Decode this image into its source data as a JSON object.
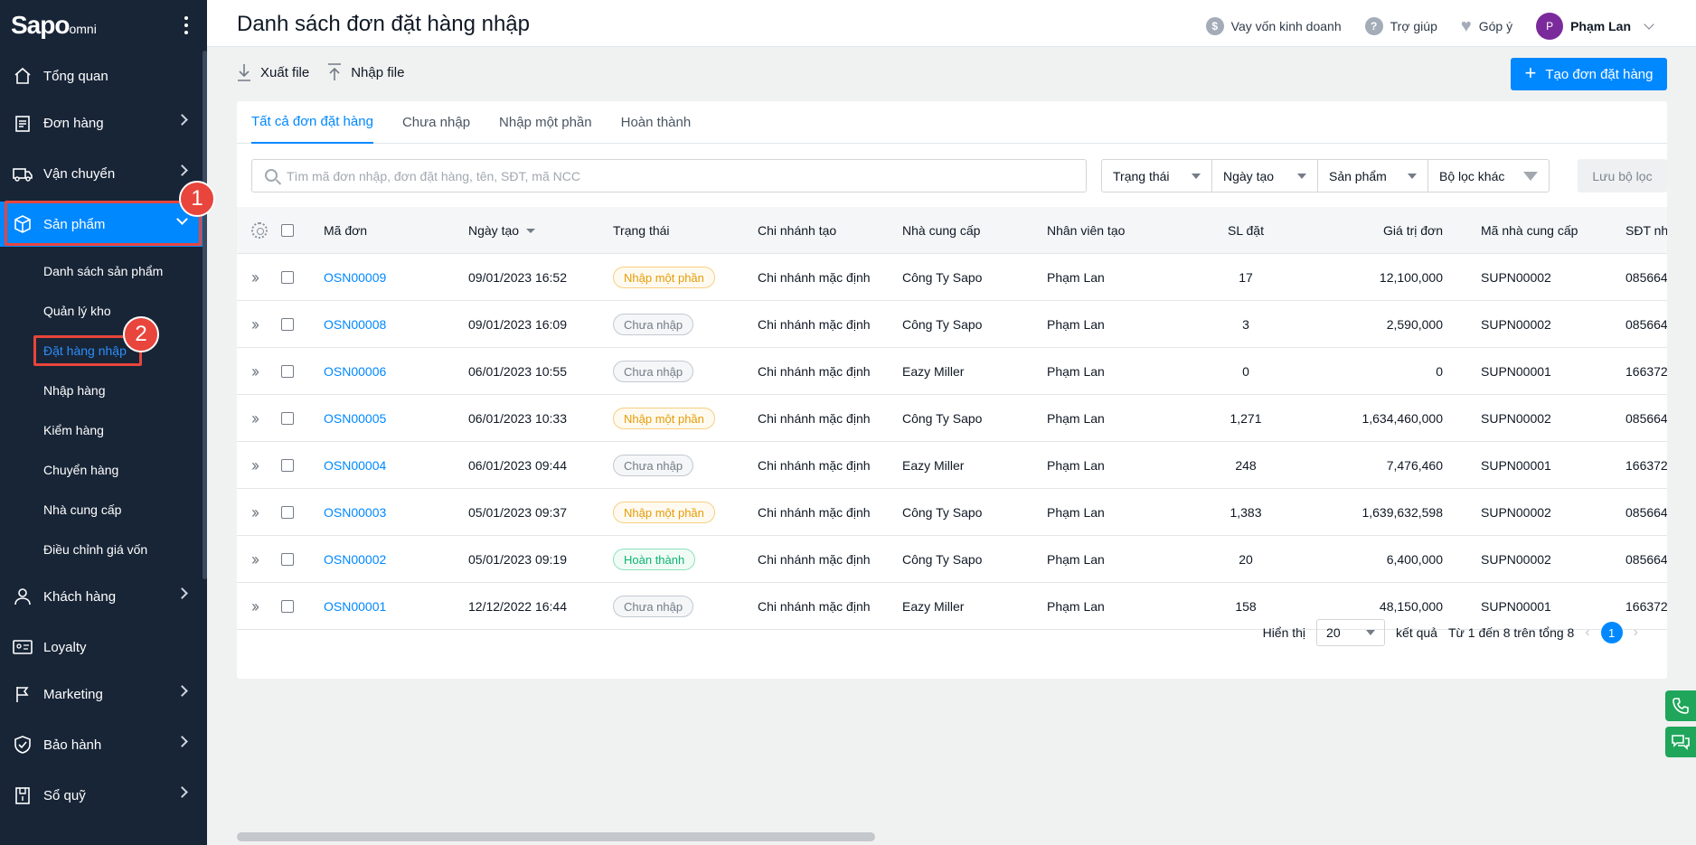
{
  "app": {
    "logo_main": "Sapo",
    "logo_sub": "omni"
  },
  "sidebar": {
    "items": [
      {
        "label": "Tổng quan",
        "icon": "home-icon"
      },
      {
        "label": "Đơn hàng",
        "icon": "clipboard-icon"
      },
      {
        "label": "Vận chuyển",
        "icon": "truck-icon"
      },
      {
        "label": "Sản phẩm",
        "icon": "box-icon"
      },
      {
        "label": "Khách hàng",
        "icon": "user-icon"
      },
      {
        "label": "Loyalty",
        "icon": "card-icon"
      },
      {
        "label": "Marketing",
        "icon": "flag-icon"
      },
      {
        "label": "Bảo hành",
        "icon": "shield-icon"
      },
      {
        "label": "Sổ quỹ",
        "icon": "ledger-icon"
      }
    ],
    "sub_items": [
      "Danh sách sản phẩm",
      "Quản lý kho",
      "Đặt hàng nhập",
      "Nhập hàng",
      "Kiểm hàng",
      "Chuyển hàng",
      "Nhà cung cấp",
      "Điều chỉnh giá vốn"
    ],
    "annotations": [
      "1",
      "2"
    ]
  },
  "header": {
    "title": "Danh sách đơn đặt hàng nhập",
    "loan": "Vay vốn kinh doanh",
    "help": "Trợ giúp",
    "feedback": "Góp ý",
    "user_initial": "P",
    "user_name": "Phạm Lan"
  },
  "toolbar": {
    "export": "Xuất file",
    "import": "Nhập file",
    "create": "Tạo đơn đặt hàng"
  },
  "tabs": [
    "Tất cả đơn đặt hàng",
    "Chưa nhập",
    "Nhập một phần",
    "Hoàn thành"
  ],
  "filters": {
    "search_placeholder": "Tìm mã đơn nhập, đơn đặt hàng, tên, SĐT, mã NCC",
    "status": "Trạng thái",
    "created_date": "Ngày tạo",
    "product": "Sản phẩm",
    "other": "Bộ lọc khác",
    "save": "Lưu bộ lọc"
  },
  "table": {
    "headers": {
      "code": "Mã đơn",
      "date": "Ngày tạo",
      "status": "Trạng thái",
      "branch": "Chi nhánh tạo",
      "supplier": "Nhà cung cấp",
      "staff": "Nhân viên tạo",
      "qty": "SL đặt",
      "value": "Giá trị đơn",
      "supplier_code": "Mã nhà cung cấp",
      "phone": "SĐT nh"
    },
    "rows": [
      {
        "code": "OSN00009",
        "date": "09/01/2023 16:52",
        "status": "Nhập một phần",
        "status_type": "partial",
        "branch": "Chi nhánh mặc định",
        "supplier": "Công Ty Sapo",
        "staff": "Phạm Lan",
        "qty": "17",
        "value": "12,100,000",
        "supplier_code": "SUPN00002",
        "phone": "085664"
      },
      {
        "code": "OSN00008",
        "date": "09/01/2023 16:09",
        "status": "Chưa nhập",
        "status_type": "none",
        "branch": "Chi nhánh mặc định",
        "supplier": "Công Ty Sapo",
        "staff": "Phạm Lan",
        "qty": "3",
        "value": "2,590,000",
        "supplier_code": "SUPN00002",
        "phone": "085664"
      },
      {
        "code": "OSN00006",
        "date": "06/01/2023 10:55",
        "status": "Chưa nhập",
        "status_type": "none",
        "branch": "Chi nhánh mặc định",
        "supplier": "Eazy Miller",
        "staff": "Phạm Lan",
        "qty": "0",
        "value": "0",
        "supplier_code": "SUPN00001",
        "phone": "166372"
      },
      {
        "code": "OSN00005",
        "date": "06/01/2023 10:33",
        "status": "Nhập một phần",
        "status_type": "partial",
        "branch": "Chi nhánh mặc định",
        "supplier": "Công Ty Sapo",
        "staff": "Phạm Lan",
        "qty": "1,271",
        "value": "1,634,460,000",
        "supplier_code": "SUPN00002",
        "phone": "085664"
      },
      {
        "code": "OSN00004",
        "date": "06/01/2023 09:44",
        "status": "Chưa nhập",
        "status_type": "none",
        "branch": "Chi nhánh mặc định",
        "supplier": "Eazy Miller",
        "staff": "Phạm Lan",
        "qty": "248",
        "value": "7,476,460",
        "supplier_code": "SUPN00001",
        "phone": "166372"
      },
      {
        "code": "OSN00003",
        "date": "05/01/2023 09:37",
        "status": "Nhập một phần",
        "status_type": "partial",
        "branch": "Chi nhánh mặc định",
        "supplier": "Công Ty Sapo",
        "staff": "Phạm Lan",
        "qty": "1,383",
        "value": "1,639,632,598",
        "supplier_code": "SUPN00002",
        "phone": "085664"
      },
      {
        "code": "OSN00002",
        "date": "05/01/2023 09:19",
        "status": "Hoàn thành",
        "status_type": "done",
        "branch": "Chi nhánh mặc định",
        "supplier": "Công Ty Sapo",
        "staff": "Phạm Lan",
        "qty": "20",
        "value": "6,400,000",
        "supplier_code": "SUPN00002",
        "phone": "085664"
      },
      {
        "code": "OSN00001",
        "date": "12/12/2022 16:44",
        "status": "Chưa nhập",
        "status_type": "none",
        "branch": "Chi nhánh mặc định",
        "supplier": "Eazy Miller",
        "staff": "Phạm Lan",
        "qty": "158",
        "value": "48,150,000",
        "supplier_code": "SUPN00001",
        "phone": "166372"
      }
    ]
  },
  "pagination": {
    "show_label": "Hiển thị",
    "page_size": "20",
    "results_label": "kết quả",
    "range_text": "Từ 1 đến 8 trên tổng 8",
    "current_page": "1"
  },
  "colors": {
    "sidebar_bg": "#182537",
    "accent": "#0088ff",
    "annotation": "#e8453c"
  }
}
